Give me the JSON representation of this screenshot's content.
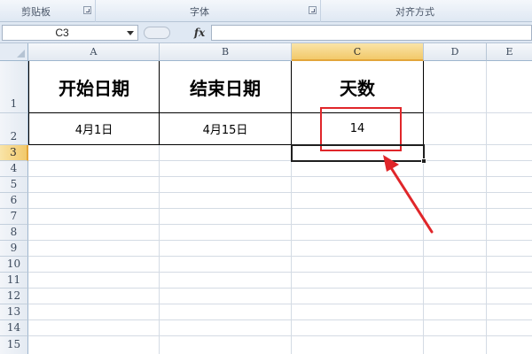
{
  "ribbon": {
    "groups": [
      {
        "label": "剪贴板"
      },
      {
        "label": "字体"
      },
      {
        "label": "对齐方式"
      }
    ]
  },
  "formula_bar": {
    "name_box": "C3",
    "fx_label": "fx",
    "formula": ""
  },
  "columns": [
    "A",
    "B",
    "C",
    "D",
    "E"
  ],
  "rows": [
    "1",
    "2",
    "3",
    "4",
    "5",
    "6",
    "7",
    "8",
    "9",
    "10",
    "11",
    "12",
    "13",
    "14",
    "15"
  ],
  "table": {
    "headers": [
      "开始日期",
      "结束日期",
      "天数"
    ],
    "values": [
      "4月1日",
      "4月15日",
      "14"
    ]
  },
  "selection": {
    "active_cell": "C3",
    "highlighted_cell": "C2"
  },
  "colors": {
    "highlight": "#e0262a",
    "selected_header": "#f2c96a"
  }
}
